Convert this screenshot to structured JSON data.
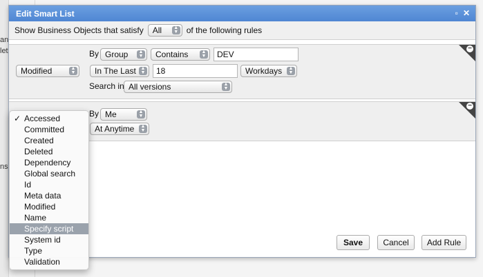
{
  "background": {
    "fragments": [
      "an",
      "lete",
      "ns)"
    ]
  },
  "dialog": {
    "title": "Edit Smart List",
    "icons": [
      "maximize-icon",
      "close-icon"
    ],
    "condition": {
      "prefix": "Show Business Objects that satisfy",
      "selected": "All",
      "suffix": "of the following rules"
    },
    "rule1": {
      "type": "Modified",
      "by_label": "By",
      "by_value": "Group",
      "match": "Contains",
      "match_text": "DEV",
      "time_mode": "In The Last",
      "time_value": "18",
      "time_unit": "Workdays",
      "search_label": "Search in",
      "search_value": "All versions"
    },
    "rule2": {
      "by_label": "By",
      "by_value": "Me",
      "time_mode": "At Anytime"
    },
    "buttons": {
      "save": "Save",
      "cancel": "Cancel",
      "add_rule": "Add Rule"
    }
  },
  "menu": {
    "items": [
      {
        "label": "Accessed",
        "checked": true,
        "highlighted": false
      },
      {
        "label": "Committed",
        "checked": false,
        "highlighted": false
      },
      {
        "label": "Created",
        "checked": false,
        "highlighted": false
      },
      {
        "label": "Deleted",
        "checked": false,
        "highlighted": false
      },
      {
        "label": "Dependency",
        "checked": false,
        "highlighted": false
      },
      {
        "label": "Global search",
        "checked": false,
        "highlighted": false
      },
      {
        "label": "Id",
        "checked": false,
        "highlighted": false
      },
      {
        "label": "Meta data",
        "checked": false,
        "highlighted": false
      },
      {
        "label": "Modified",
        "checked": false,
        "highlighted": false
      },
      {
        "label": "Name",
        "checked": false,
        "highlighted": false
      },
      {
        "label": "Specify script",
        "checked": false,
        "highlighted": true
      },
      {
        "label": "System id",
        "checked": false,
        "highlighted": false
      },
      {
        "label": "Type",
        "checked": false,
        "highlighted": false
      },
      {
        "label": "Validation",
        "checked": false,
        "highlighted": false
      }
    ],
    "check_glyph": "✓"
  }
}
